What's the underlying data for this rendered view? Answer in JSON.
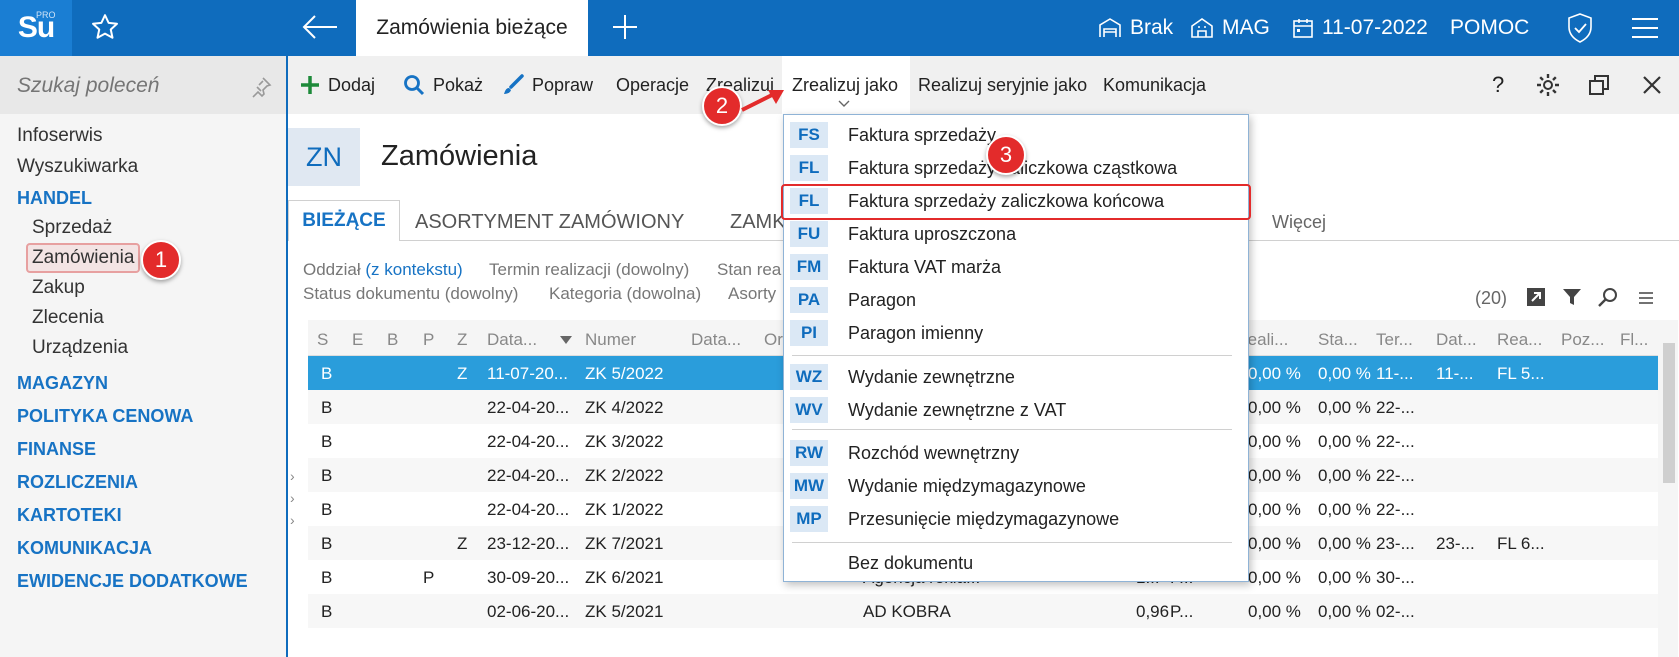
{
  "app": {
    "logo": "Su",
    "logo_pro": "PRO",
    "active_tab": "Zamówienia bieżące"
  },
  "topbar": {
    "warehouse_status": "Brak",
    "warehouse": "MAG",
    "date": "11-07-2022",
    "help": "POMOC"
  },
  "sidebar": {
    "search_placeholder": "Szukaj poleceń",
    "items": [
      {
        "label": "Infoserwis"
      },
      {
        "label": "Wyszukiwarka"
      },
      {
        "label": "HANDEL"
      },
      {
        "label": "Sprzedaż"
      },
      {
        "label": "Zamówienia"
      },
      {
        "label": "Zakup"
      },
      {
        "label": "Zlecenia"
      },
      {
        "label": "Urządzenia"
      },
      {
        "label": "MAGAZYN"
      },
      {
        "label": "POLITYKA CENOWA"
      },
      {
        "label": "FINANSE"
      },
      {
        "label": "ROZLICZENIA"
      },
      {
        "label": "KARTOTEKI"
      },
      {
        "label": "KOMUNIKACJA"
      },
      {
        "label": "EWIDENCJE DODATKOWE"
      }
    ]
  },
  "toolbar": {
    "add": "Dodaj",
    "show": "Pokaż",
    "edit": "Popraw",
    "operations": "Operacje",
    "realize": "Zrealizuj",
    "realize_as": "Zrealizuj jako",
    "realize_serial": "Realizuj seryjnie jako",
    "communication": "Komunikacja",
    "help": "?"
  },
  "main": {
    "badge": "ZN",
    "title": "Zamówienia",
    "tabs": [
      "BIEŻĄCE",
      "ASORTYMENT ZAMÓWIONY",
      "ZAMK",
      "Więcej"
    ],
    "filters": {
      "branch_label": "Oddział",
      "branch_value": "(z kontekstu)",
      "deadline": "Termin realizacji (dowolny)",
      "state": "Stan rea",
      "doc_status": "Status dokumentu (dowolny)",
      "category": "Kategoria (dowolna)",
      "assortment": "Asorty"
    },
    "count": "(20)"
  },
  "grid": {
    "headers": [
      "S",
      "E",
      "B",
      "P",
      "Z",
      "Data...",
      "Numer",
      "Data...",
      "Or",
      "reali...",
      "Sta...",
      "Ter...",
      "Dat...",
      "Rea...",
      "Poz...",
      "Fl..."
    ],
    "rows": [
      {
        "s": "B",
        "p": "",
        "z": "Z",
        "data": "11-07-20...",
        "numer": "ZK 5/2022",
        "kontr": "",
        "val": "",
        "st": "",
        "real": "0,00 %",
        "sta": "0,00 %",
        "ter": "11-...",
        "dat": "11-...",
        "rea": "FL 5..."
      },
      {
        "s": "B",
        "p": "",
        "z": "",
        "data": "22-04-20...",
        "numer": "ZK 4/2022",
        "kontr": "",
        "val": "",
        "st": "",
        "real": "0,00 %",
        "sta": "0,00 %",
        "ter": "22-...",
        "dat": "",
        "rea": ""
      },
      {
        "s": "B",
        "p": "",
        "z": "",
        "data": "22-04-20...",
        "numer": "ZK 3/2022",
        "kontr": "",
        "val": "",
        "st": "",
        "real": "0,00 %",
        "sta": "0,00 %",
        "ter": "22-...",
        "dat": "",
        "rea": ""
      },
      {
        "s": "B",
        "p": "",
        "z": "",
        "data": "22-04-20...",
        "numer": "ZK 2/2022",
        "kontr": "",
        "val": "",
        "st": "",
        "real": "0,00 %",
        "sta": "0,00 %",
        "ter": "22-...",
        "dat": "",
        "rea": ""
      },
      {
        "s": "B",
        "p": "",
        "z": "",
        "data": "22-04-20...",
        "numer": "ZK 1/2022",
        "kontr": "",
        "val": "",
        "st": "",
        "real": "0,00 %",
        "sta": "0,00 %",
        "ter": "22-...",
        "dat": "",
        "rea": ""
      },
      {
        "s": "B",
        "p": "",
        "z": "Z",
        "data": "23-12-20...",
        "numer": "ZK 7/2021",
        "kontr": "",
        "val": "",
        "st": "",
        "real": "0,00 %",
        "sta": "0,00 %",
        "ter": "23-...",
        "dat": "23-...",
        "rea": "FL 6..."
      },
      {
        "s": "B",
        "p": "P",
        "z": "",
        "data": "30-09-20...",
        "numer": "ZK 6/2021",
        "kontr": "Agencja rekla...",
        "val": "1...",
        "st": "P...",
        "real": "0,00 %",
        "sta": "0,00 %",
        "ter": "30-...",
        "dat": "",
        "rea": ""
      },
      {
        "s": "B",
        "p": "",
        "z": "",
        "data": "02-06-20...",
        "numer": "ZK 5/2021",
        "kontr": "AD KOBRA",
        "val": "0,96",
        "st": "P...",
        "real": "0,00 %",
        "sta": "0,00 %",
        "ter": "02-...",
        "dat": "",
        "rea": ""
      }
    ]
  },
  "dropdown": {
    "items": [
      {
        "code": "FS",
        "label": "Faktura sprzedaży"
      },
      {
        "code": "FL",
        "label": "Faktura sprzedaży zaliczkowa cząstkowa"
      },
      {
        "code": "FL",
        "label": "Faktura sprzedaży zaliczkowa końcowa"
      },
      {
        "code": "FU",
        "label": "Faktura uproszczona"
      },
      {
        "code": "FM",
        "label": "Faktura VAT marża"
      },
      {
        "code": "PA",
        "label": "Paragon"
      },
      {
        "code": "PI",
        "label": "Paragon imienny"
      },
      {
        "code": "WZ",
        "label": "Wydanie zewnętrzne"
      },
      {
        "code": "WV",
        "label": "Wydanie zewnętrzne z VAT"
      },
      {
        "code": "RW",
        "label": "Rozchód wewnętrzny"
      },
      {
        "code": "MW",
        "label": "Wydanie międzymagazynowe"
      },
      {
        "code": "MP",
        "label": "Przesunięcie międzymagazynowe"
      },
      {
        "code": "",
        "label": "Bez dokumentu"
      }
    ]
  },
  "annotations": [
    "1",
    "2",
    "3"
  ],
  "colors": {
    "brand": "#0f6cbd",
    "selection": "#2a9ddb",
    "annotation": "#e32b2b"
  }
}
